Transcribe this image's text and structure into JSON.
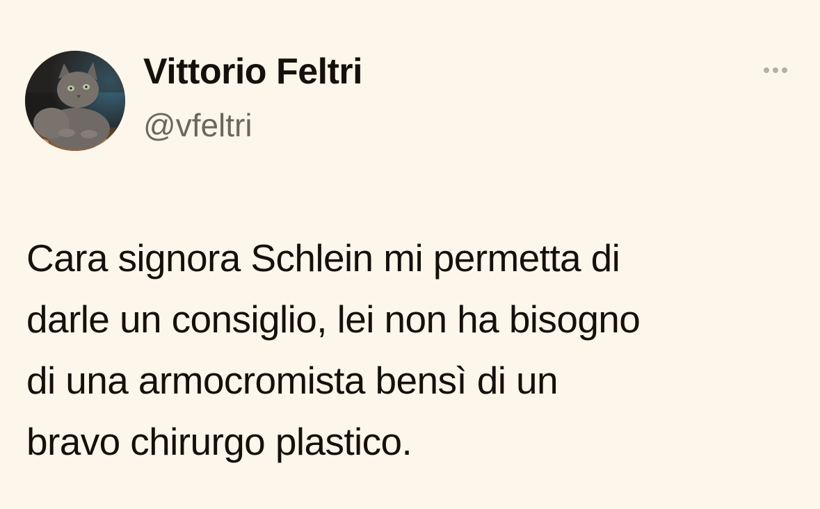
{
  "author": {
    "display_name": "Vittorio Feltri",
    "handle": "@vfeltri",
    "avatar_icon": "cat-avatar"
  },
  "more_menu_icon": "more-horizontal-icon",
  "tweet": {
    "lines": [
      "Cara signora Schlein mi permetta di",
      "darle un consiglio, lei non ha bisogno",
      "di una armocromista bensì di un",
      "bravo chirurgo plastico."
    ]
  },
  "colors": {
    "background": "#fdf6ea",
    "text": "#15100b",
    "secondary_text": "#6b6661",
    "icon": "#b4aea6"
  }
}
